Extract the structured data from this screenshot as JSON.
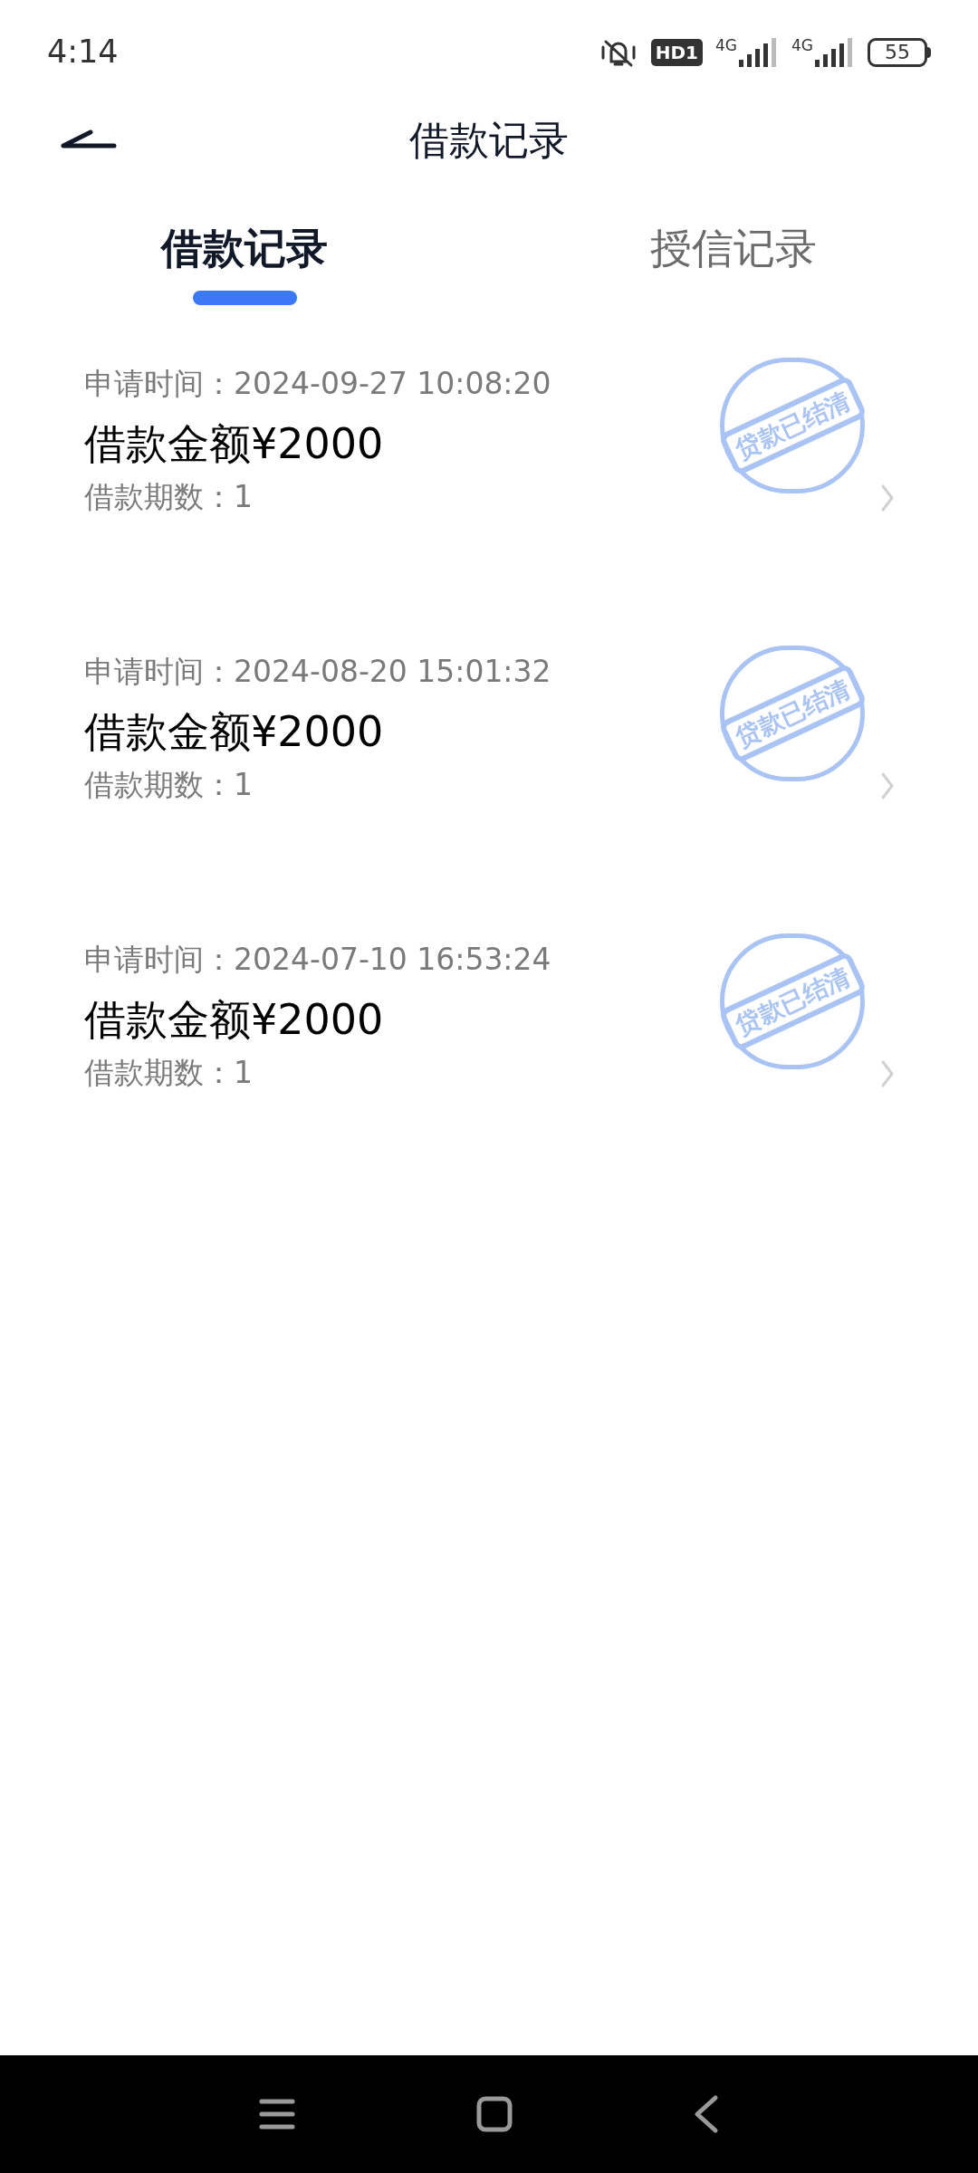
{
  "status_bar": {
    "time": "4:14",
    "hd_badge": "HD1",
    "network_1": "4G",
    "network_2": "4G",
    "battery": "55"
  },
  "header": {
    "title": "借款记录"
  },
  "tabs": [
    {
      "label": "借款记录",
      "selected": true
    },
    {
      "label": "授信记录",
      "selected": false
    }
  ],
  "records": [
    {
      "apply_time": "申请时间：2024-09-27 10:08:20",
      "amount": "借款金额¥2000",
      "periods": "借款期数：1",
      "stamp": "贷款已结清"
    },
    {
      "apply_time": "申请时间：2024-08-20 15:01:32",
      "amount": "借款金额¥2000",
      "periods": "借款期数：1",
      "stamp": "贷款已结清"
    },
    {
      "apply_time": "申请时间：2024-07-10 16:53:24",
      "amount": "借款金额¥2000",
      "periods": "借款期数：1",
      "stamp": "贷款已结清"
    }
  ]
}
